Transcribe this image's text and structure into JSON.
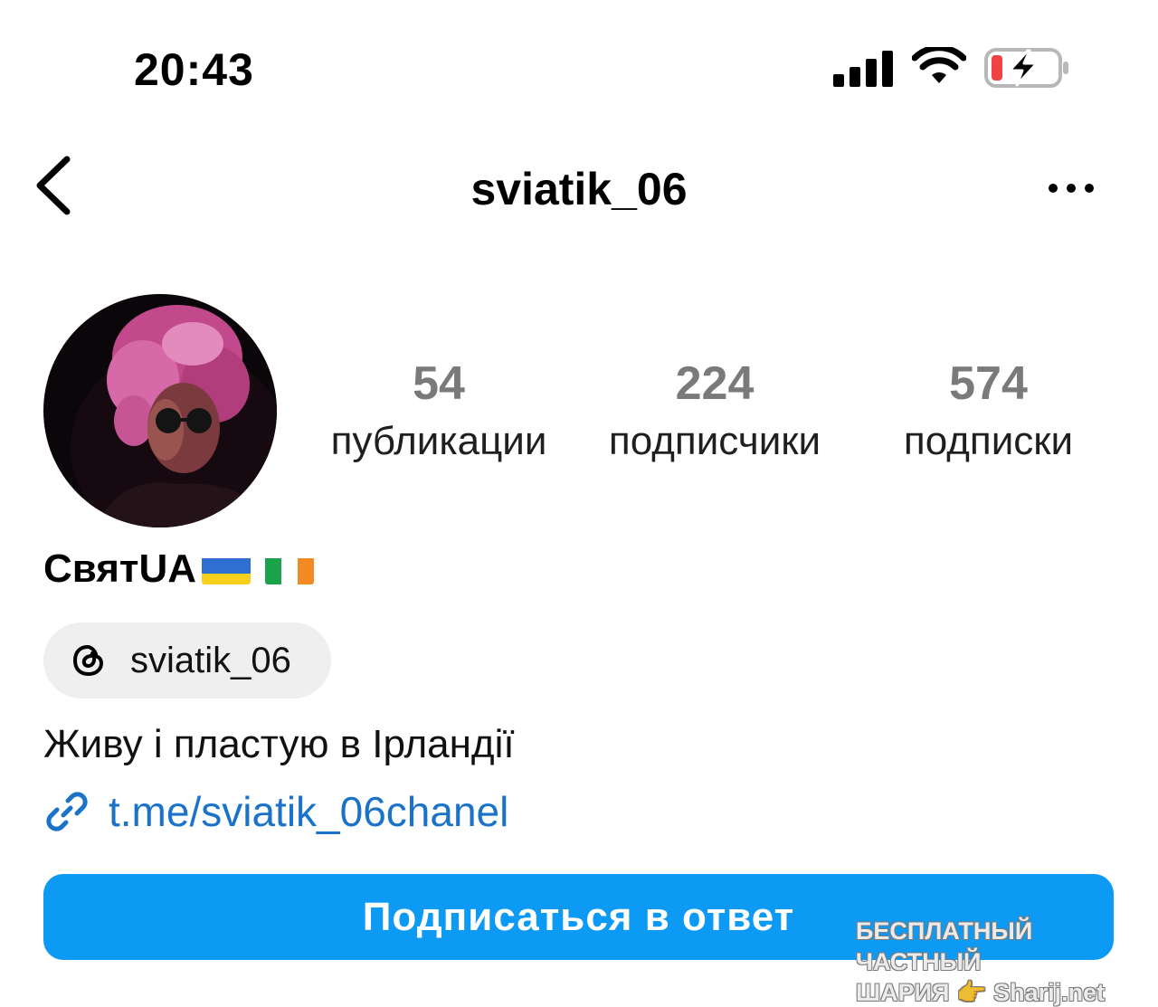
{
  "status_bar": {
    "time": "20:43",
    "signal_icon": "cellular-signal-icon",
    "wifi_icon": "wifi-icon",
    "battery_icon": "battery-charging-icon",
    "battery_level": 0.15
  },
  "nav": {
    "back_icon": "chevron-left-icon",
    "username": "sviatik_06",
    "more_icon": "more-horizontal-icon"
  },
  "profile": {
    "stats": [
      {
        "value": "54",
        "label": "публикации"
      },
      {
        "value": "224",
        "label": "подписчики"
      },
      {
        "value": "574",
        "label": "подписки"
      }
    ],
    "display_name": "СвятUA",
    "flags": [
      "ukraine-flag",
      "ireland-flag"
    ],
    "threads": {
      "icon": "threads-icon",
      "handle": "sviatik_06"
    },
    "bio": "Живу і пластую в Ірландії",
    "link": {
      "icon": "link-icon",
      "text": "t.me/sviatik_06chanel"
    },
    "follow_button": "Подписаться в ответ"
  },
  "watermark": {
    "line1": "БЕСПЛАТНЫЙ ЧАСТНЫЙ",
    "line2": "ШАРИЯ 👉 Sharij.net"
  },
  "colors": {
    "accent": "#0c9af5",
    "link": "#1a73c9",
    "stat_number": "#7a7a7a",
    "battery_low": "#f04444"
  }
}
